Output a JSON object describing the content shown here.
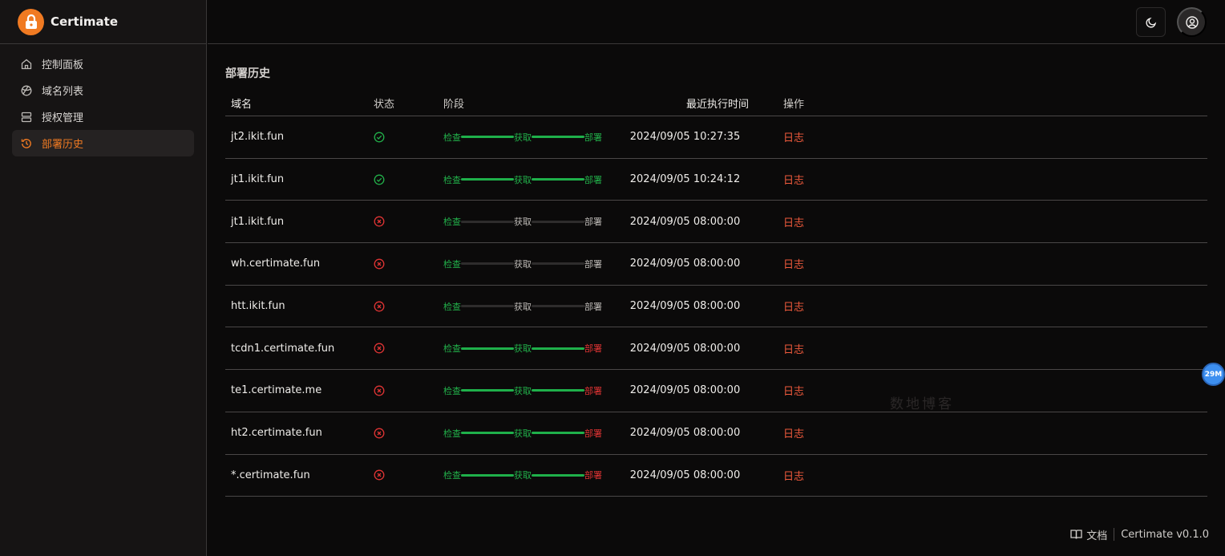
{
  "app": {
    "brand": "Certimate"
  },
  "sidebar": {
    "items": [
      {
        "label": "控制面板",
        "icon": "home-icon",
        "active": false
      },
      {
        "label": "域名列表",
        "icon": "globe-icon",
        "active": false
      },
      {
        "label": "授权管理",
        "icon": "server-icon",
        "active": false
      },
      {
        "label": "部署历史",
        "icon": "history-icon",
        "active": true
      }
    ]
  },
  "header": {
    "theme_icon": "moon-icon",
    "user_icon": "user-circle-icon"
  },
  "page": {
    "title": "部署历史"
  },
  "table": {
    "columns": [
      "域名",
      "状态",
      "阶段",
      "最近执行时间",
      "操作"
    ],
    "stage_labels": [
      "检查",
      "获取",
      "部署"
    ],
    "rows": [
      {
        "domain": "jt2.ikit.fun",
        "status": "success",
        "stages": [
          "ok",
          "ok",
          "ok"
        ],
        "time": "2024/09/05 10:27:35",
        "action": "日志"
      },
      {
        "domain": "jt1.ikit.fun",
        "status": "success",
        "stages": [
          "ok",
          "ok",
          "ok"
        ],
        "time": "2024/09/05 10:24:12",
        "action": "日志"
      },
      {
        "domain": "jt1.ikit.fun",
        "status": "failed",
        "stages": [
          "ok",
          "pending",
          "pending"
        ],
        "time": "2024/09/05 08:00:00",
        "action": "日志"
      },
      {
        "domain": "wh.certimate.fun",
        "status": "failed",
        "stages": [
          "ok",
          "pending",
          "pending"
        ],
        "time": "2024/09/05 08:00:00",
        "action": "日志"
      },
      {
        "domain": "htt.ikit.fun",
        "status": "failed",
        "stages": [
          "ok",
          "pending",
          "pending"
        ],
        "time": "2024/09/05 08:00:00",
        "action": "日志"
      },
      {
        "domain": "tcdn1.certimate.fun",
        "status": "failed",
        "stages": [
          "ok",
          "ok",
          "fail"
        ],
        "time": "2024/09/05 08:00:00",
        "action": "日志"
      },
      {
        "domain": "te1.certimate.me",
        "status": "failed",
        "stages": [
          "ok",
          "ok",
          "fail"
        ],
        "time": "2024/09/05 08:00:00",
        "action": "日志"
      },
      {
        "domain": "ht2.certimate.fun",
        "status": "failed",
        "stages": [
          "ok",
          "ok",
          "fail"
        ],
        "time": "2024/09/05 08:00:00",
        "action": "日志"
      },
      {
        "domain": "*.certimate.fun",
        "status": "failed",
        "stages": [
          "ok",
          "ok",
          "fail"
        ],
        "time": "2024/09/05 08:00:00",
        "action": "日志"
      }
    ]
  },
  "footer": {
    "docs": "文档",
    "version": "Certimate v0.1.0"
  },
  "overlay": {
    "badge": "29M",
    "watermark": "数地博客"
  },
  "colors": {
    "accent": "#f07a22",
    "success": "#22b04a",
    "danger": "#e03434",
    "link": "#ef5a3c"
  }
}
